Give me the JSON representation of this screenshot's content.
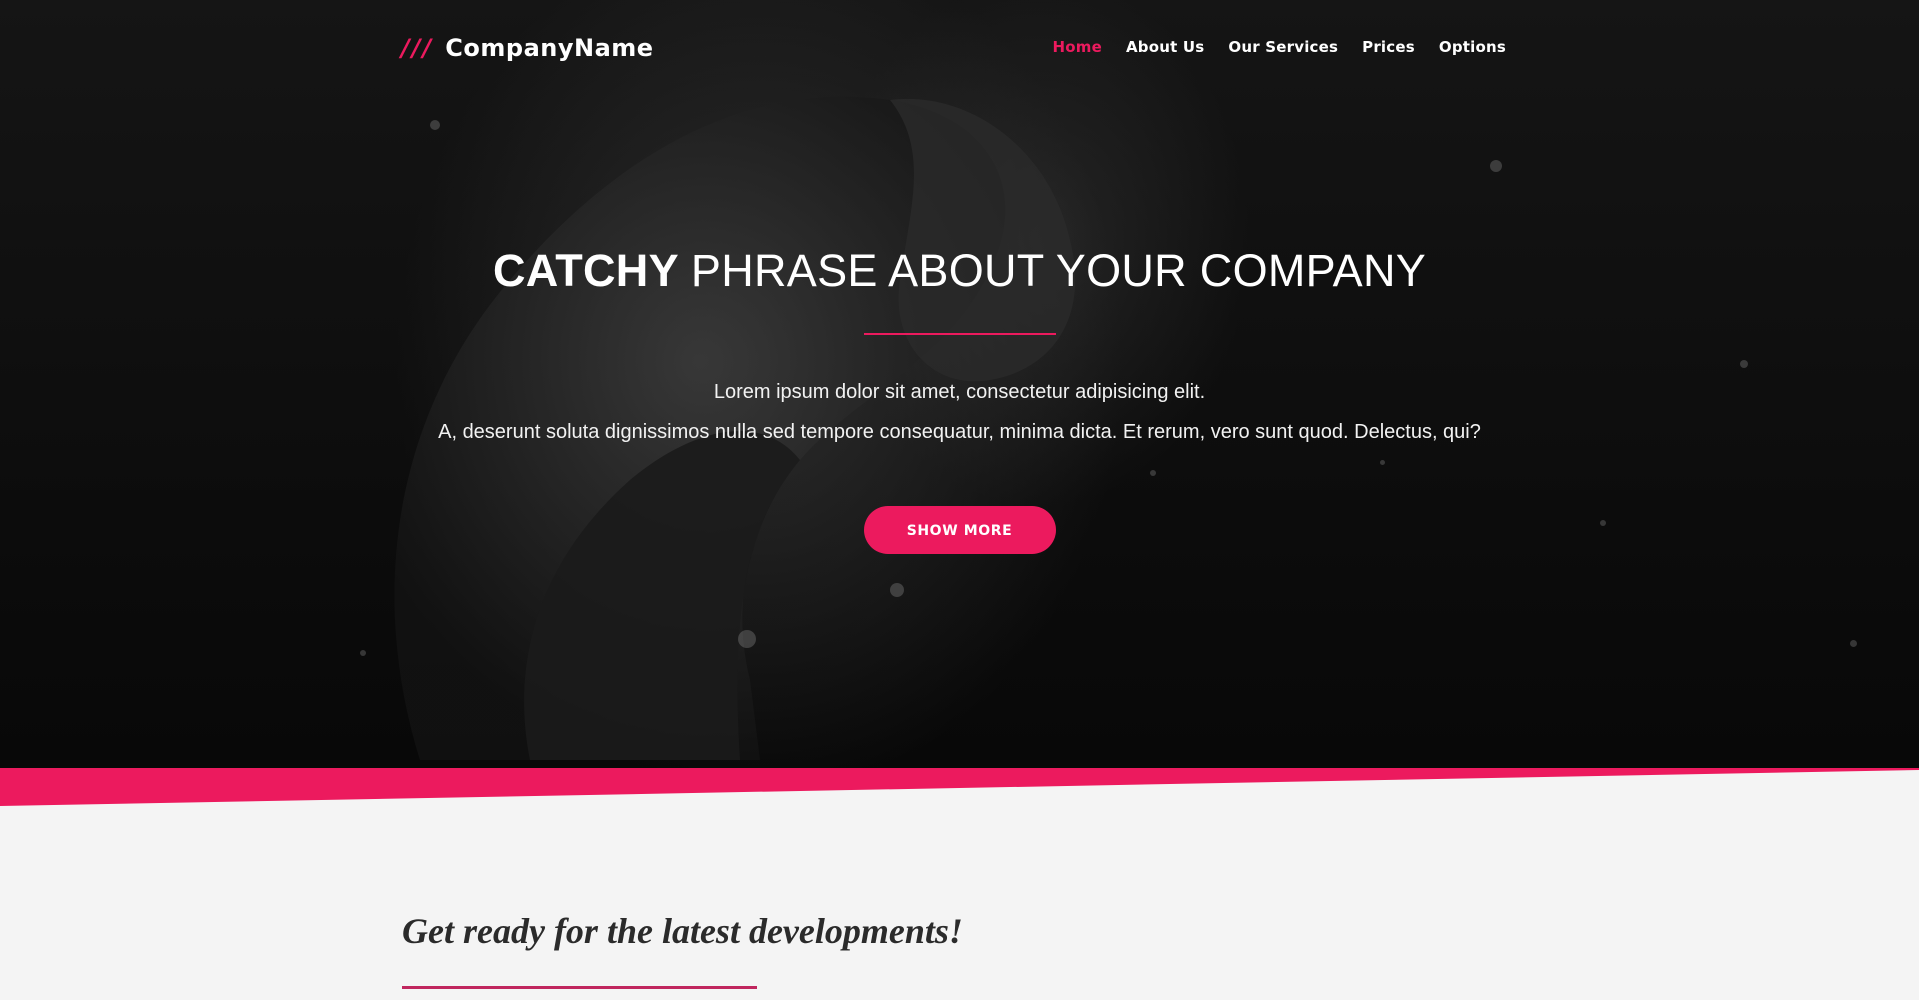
{
  "brand": {
    "mark": "///",
    "name": "CompanyName"
  },
  "nav": {
    "items": [
      {
        "label": "Home",
        "active": true
      },
      {
        "label": "About Us",
        "active": false
      },
      {
        "label": "Our Services",
        "active": false
      },
      {
        "label": "Prices",
        "active": false
      },
      {
        "label": "Options",
        "active": false
      }
    ]
  },
  "hero": {
    "headline_strong": "CATCHY",
    "headline_rest": "PHRASE ABOUT YOUR COMPANY",
    "line1": "Lorem ipsum dolor sit amet, consectetur adipisicing elit.",
    "line2": "A, deserunt soluta dignissimos nulla sed tempore consequatur, minima dicta. Et rerum, vero sunt quod. Delectus, qui?",
    "button_label": "SHOW MORE"
  },
  "section": {
    "title": "Get ready for the latest developments!"
  },
  "colors": {
    "accent": "#ec1a5e",
    "hero_bg": "#0d0d0d",
    "section_bg": "#f4f4f4",
    "title_text": "#2b2b2b"
  }
}
